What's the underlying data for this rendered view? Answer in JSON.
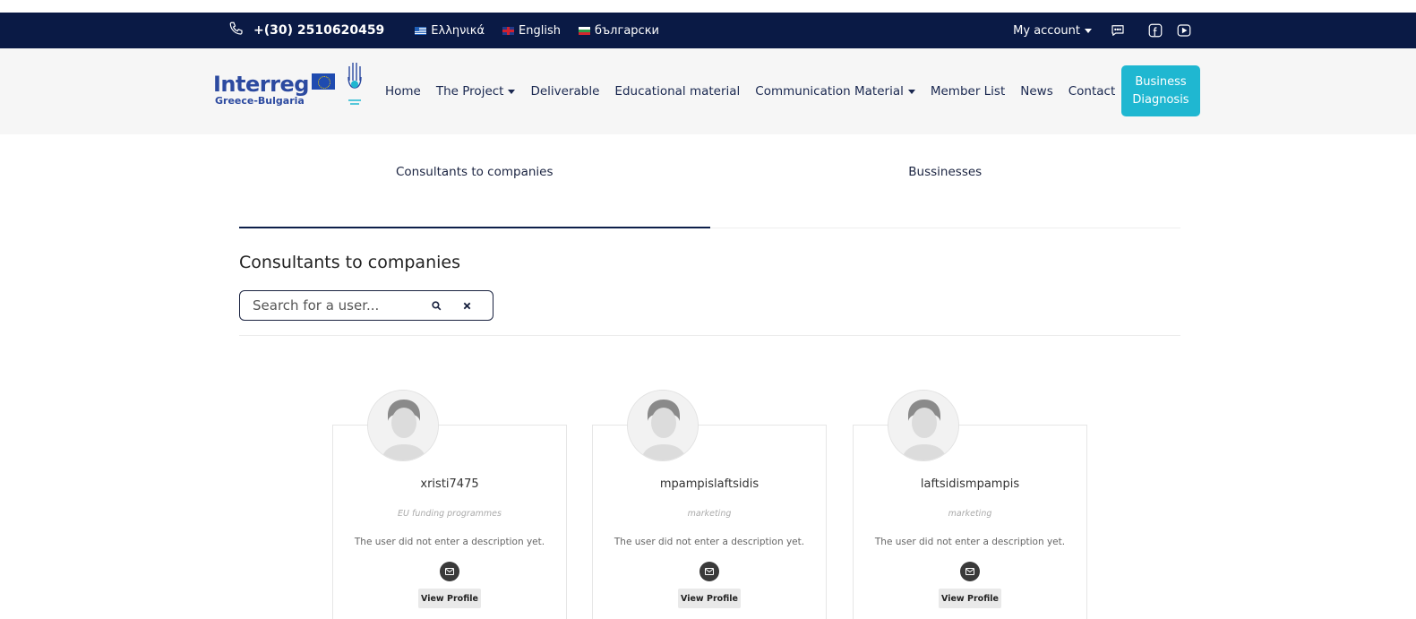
{
  "topbar": {
    "phone": "+(30) 2510620459",
    "languages": [
      {
        "label": "Ελληνικά",
        "flag": "greece"
      },
      {
        "label": "English",
        "flag": "uk"
      },
      {
        "label": "български",
        "flag": "bulgaria"
      }
    ],
    "account_label": "My account",
    "icons": [
      "chat-icon",
      "facebook-icon",
      "youtube-icon"
    ],
    "bg_color": "#0a1a45"
  },
  "header": {
    "logo": {
      "word": "Interreg",
      "sub": "Greece-Bulgaria"
    },
    "nav": [
      {
        "label": "Home",
        "dropdown": false
      },
      {
        "label": "The Project",
        "dropdown": true
      },
      {
        "label": "Deliverable",
        "dropdown": false
      },
      {
        "label": "Educational material",
        "dropdown": false
      },
      {
        "label": "Communication Material",
        "dropdown": true
      },
      {
        "label": "Member List",
        "dropdown": false
      },
      {
        "label": "News",
        "dropdown": false
      },
      {
        "label": "Contact",
        "dropdown": false
      }
    ],
    "cta_label": "Business Diagnosis",
    "cta_color": "#1fb7d1"
  },
  "tabs": [
    {
      "label": "Consultants to companies",
      "active": true
    },
    {
      "label": "Bussinesses",
      "active": false
    }
  ],
  "section": {
    "title": "Consultants to companies",
    "search_placeholder": "Search for a user..."
  },
  "members": [
    {
      "username": "xristi7475",
      "role": "EU funding programmes",
      "description": "The user did not enter a description yet.",
      "button": "View Profile"
    },
    {
      "username": "mpampislaftsidis",
      "role": "marketing",
      "description": "The user did not enter a description yet.",
      "button": "View Profile"
    },
    {
      "username": "laftsidismpampis",
      "role": "marketing",
      "description": "The user did not enter a description yet.",
      "button": "View Profile"
    }
  ]
}
